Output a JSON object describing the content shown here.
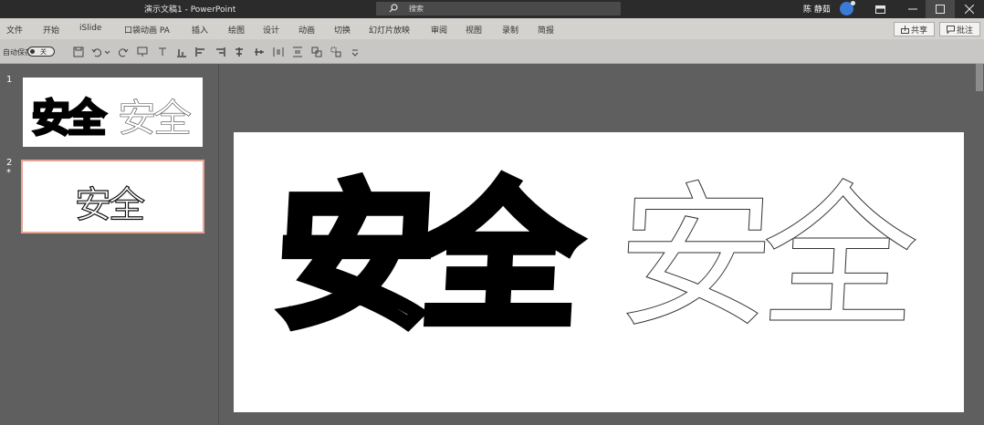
{
  "titlebar": {
    "title": "演示文稿1  -  PowerPoint",
    "search_label": "搜索",
    "user_name": "陈 静茹"
  },
  "menubar": {
    "tabs": [
      "文件",
      "开始",
      "iSlide",
      "口袋动画 PA",
      "插入",
      "绘图",
      "设计",
      "动画",
      "切换",
      "幻灯片放映",
      "审阅",
      "视图",
      "录制",
      "简报"
    ],
    "share_label": "共享",
    "comment_label": "批注"
  },
  "qat": {
    "autosave_label": "自动保存",
    "toggle_label": "关"
  },
  "thumbnails": {
    "slide1_number": "1",
    "slide2_number": "2",
    "slide2_star": "*",
    "slide1_text_bold": "安全",
    "slide1_text_outline": "安全",
    "slide2_text": "安全"
  },
  "slide": {
    "text_bold": "安全",
    "text_outline": "安全"
  },
  "colors": {
    "titlebar_bg": "#2b2b2b",
    "menubar_bg": "#d4d2cf",
    "workspace_bg": "#5f5f5f",
    "selected_thumb_border": "#e8a393",
    "avatar": "#3b7bd6"
  }
}
